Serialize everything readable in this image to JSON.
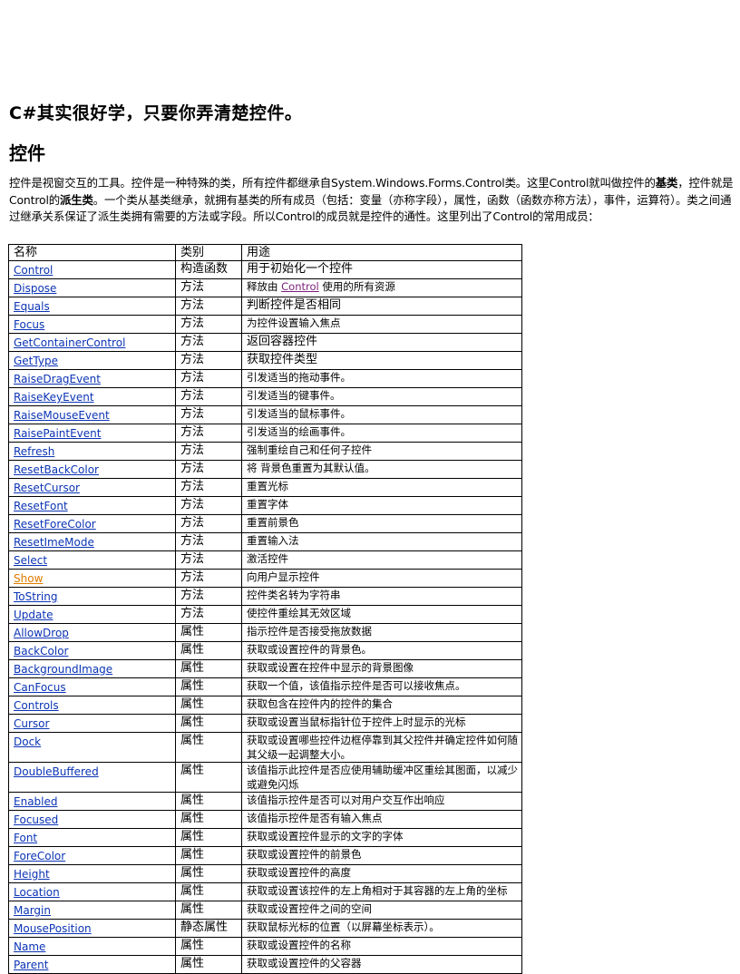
{
  "title": "C#其实很好学，只要你弄清楚控件。",
  "section_heading": "控件",
  "intro": {
    "part1": "控件是视窗交互的工具。控件是一种特殊的类，所有控件都继承自System.Windows.Forms.Control类。这里Control就叫做控件的",
    "bold1": "基类",
    "part2": "，控件就是Control的",
    "bold2": "派生类",
    "part3": "。一个类从基类继承，就拥有基类的所有成员（包括：变量（亦称字段），属性，函数（函数亦称方法），事件，运算符）。类之间通过继承关系保证了派生类拥有需要的方法或字段。所以Control的成员就是控件的通性。这里列出了Control的常用成员："
  },
  "table": {
    "headers": [
      "名称",
      "类别",
      "用途"
    ],
    "rows": [
      {
        "name": "Control",
        "kind": "构造函数",
        "purpose": "用于初始化一个控件",
        "big": true
      },
      {
        "name": "Dispose",
        "kind": "方法",
        "purpose_pre": "释放由 ",
        "purpose_link": "Control",
        "purpose_post": " 使用的所有资源"
      },
      {
        "name": "Equals",
        "kind": "方法",
        "purpose": "判断控件是否相同",
        "big": true
      },
      {
        "name": "Focus",
        "kind": "方法",
        "purpose": "为控件设置输入焦点"
      },
      {
        "name": "GetContainerControl",
        "kind": "方法",
        "purpose": "返回容器控件",
        "big": true
      },
      {
        "name": "GetType",
        "kind": "方法",
        "purpose": "获取控件类型",
        "big": true
      },
      {
        "name": "RaiseDragEvent",
        "kind": "方法",
        "purpose": "引发适当的拖动事件。"
      },
      {
        "name": "RaiseKeyEvent",
        "kind": "方法",
        "purpose": "引发适当的键事件。"
      },
      {
        "name": "RaiseMouseEvent",
        "kind": "方法",
        "purpose": "引发适当的鼠标事件。"
      },
      {
        "name": "RaisePaintEvent",
        "kind": "方法",
        "purpose": "引发适当的绘画事件。"
      },
      {
        "name": "Refresh",
        "kind": "方法",
        "purpose": "强制重绘自己和任何子控件"
      },
      {
        "name": "ResetBackColor",
        "kind": "方法",
        "purpose": "将 背景色重置为其默认值。"
      },
      {
        "name": "ResetCursor",
        "kind": "方法",
        "purpose": "重置光标"
      },
      {
        "name": "ResetFont",
        "kind": "方法",
        "purpose": "重置字体"
      },
      {
        "name": "ResetForeColor",
        "kind": "方法",
        "purpose": "重置前景色"
      },
      {
        "name": "ResetImeMode",
        "kind": "方法",
        "purpose": "重置输入法"
      },
      {
        "name": "Select",
        "kind": "方法",
        "purpose": "激活控件"
      },
      {
        "name": "Show",
        "kind": "方法",
        "purpose": "向用户显示控件",
        "orange": true
      },
      {
        "name": "ToString",
        "kind": "方法",
        "purpose": "控件类名转为字符串"
      },
      {
        "name": "Update",
        "kind": "方法",
        "purpose": "使控件重绘其无效区域"
      },
      {
        "name": "AllowDrop",
        "kind": "属性",
        "purpose": "指示控件是否接受拖放数据"
      },
      {
        "name": "BackColor",
        "kind": "属性",
        "purpose": "获取或设置控件的背景色。"
      },
      {
        "name": "BackgroundImage",
        "kind": "属性",
        "purpose": "获取或设置在控件中显示的背景图像"
      },
      {
        "name": "CanFocus",
        "kind": "属性",
        "purpose": "获取一个值，该值指示控件是否可以接收焦点。"
      },
      {
        "name": "Controls",
        "kind": "属性",
        "purpose": "获取包含在控件内的控件的集合"
      },
      {
        "name": "Cursor",
        "kind": "属性",
        "purpose": "获取或设置当鼠标指针位于控件上时显示的光标"
      },
      {
        "name": "Dock",
        "kind": "属性",
        "purpose": "获取或设置哪些控件边框停靠到其父控件并确定控件如何随其父级一起调整大小。",
        "multi": true
      },
      {
        "name": "DoubleBuffered",
        "kind": "属性",
        "purpose": "该值指示此控件是否应使用辅助缓冲区重绘其图面，以减少或避免闪烁",
        "multi": true
      },
      {
        "name": "Enabled",
        "kind": "属性",
        "purpose": "该值指示控件是否可以对用户交互作出响应"
      },
      {
        "name": "Focused",
        "kind": "属性",
        "purpose": "该值指示控件是否有输入焦点"
      },
      {
        "name": "Font",
        "kind": "属性",
        "purpose": "获取或设置控件显示的文字的字体"
      },
      {
        "name": "ForeColor",
        "kind": "属性",
        "purpose": "获取或设置控件的前景色"
      },
      {
        "name": "Height",
        "kind": "属性",
        "purpose": "获取或设置控件的高度"
      },
      {
        "name": "Location",
        "kind": "属性",
        "purpose": "获取或设置该控件的左上角相对于其容器的左上角的坐标",
        "multi": true
      },
      {
        "name": "Margin",
        "kind": "属性",
        "purpose": "获取或设置控件之间的空间"
      },
      {
        "name": "MousePosition",
        "kind": "静态属性",
        "purpose": "获取鼠标光标的位置（以屏幕坐标表示）。"
      },
      {
        "name": "Name",
        "kind": "属性",
        "purpose": "获取或设置控件的名称"
      },
      {
        "name": "Parent",
        "kind": "属性",
        "purpose": "获取或设置控件的父容器"
      }
    ]
  }
}
